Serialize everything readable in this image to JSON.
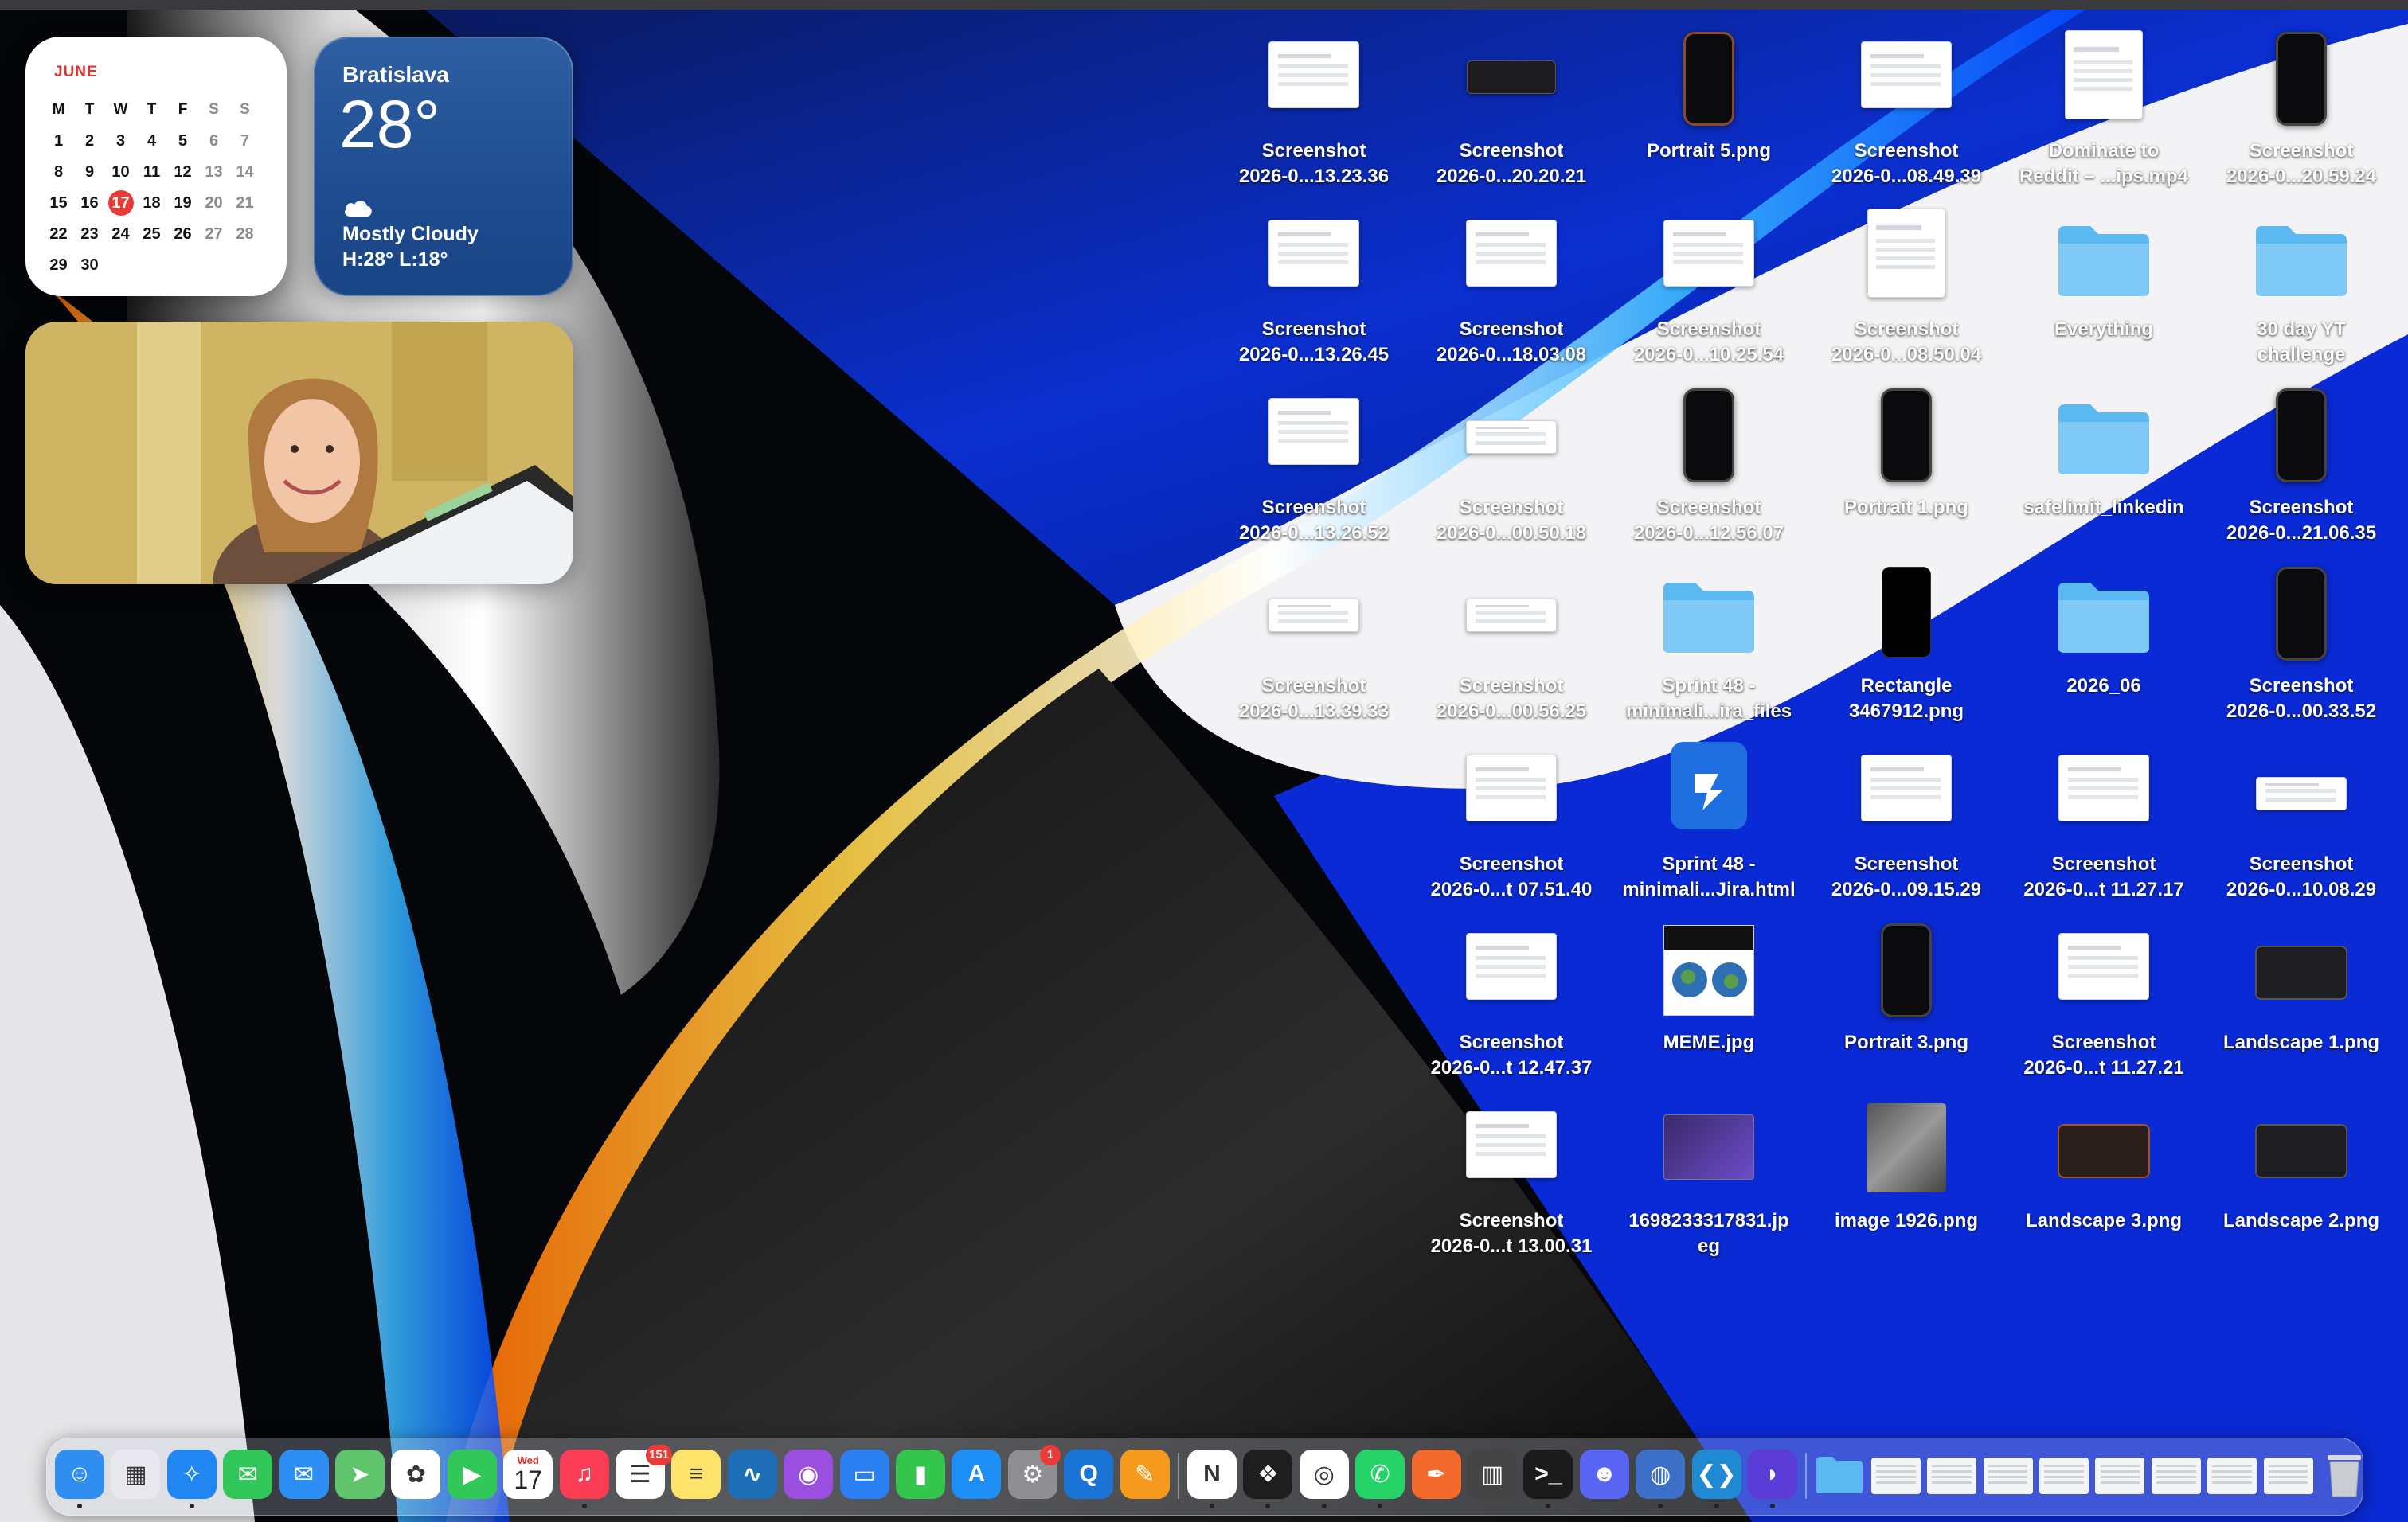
{
  "calendar": {
    "month": "JUNE",
    "weekdays": [
      "M",
      "T",
      "W",
      "T",
      "F",
      "S",
      "S"
    ],
    "weeks": [
      [
        "",
        "",
        "",
        "",
        "",
        "",
        ""
      ],
      [
        "1",
        "2",
        "3",
        "4",
        "5",
        "6",
        "7"
      ],
      [
        "8",
        "9",
        "10",
        "11",
        "12",
        "13",
        "14"
      ],
      [
        "15",
        "16",
        "17",
        "18",
        "19",
        "20",
        "21"
      ],
      [
        "22",
        "23",
        "24",
        "25",
        "26",
        "27",
        "28"
      ],
      [
        "29",
        "30",
        "",
        "",
        "",
        "",
        ""
      ]
    ],
    "today": "17"
  },
  "weather": {
    "city": "Bratislava",
    "temp": "28°",
    "condition": "Mostly Cloudy",
    "high_low": "H:28° L:18°",
    "icon": "cloud-icon"
  },
  "camera": {
    "icon": "webcam-preview"
  },
  "desktop_items": [
    {
      "label1": "Screenshot",
      "label2": "2026-0...13.23.36",
      "kind": "shot"
    },
    {
      "label1": "Screenshot",
      "label2": "2026-0...20.20.21",
      "kind": "dark"
    },
    {
      "label1": "Portrait 5.png",
      "label2": "",
      "kind": "phone-orange"
    },
    {
      "label1": "Screenshot",
      "label2": "2026-0...08.49.39",
      "kind": "shot"
    },
    {
      "label1": "Dominate to",
      "label2": "Reddit – ...ips.mp4",
      "kind": "shot-tall"
    },
    {
      "label1": "Screenshot",
      "label2": "2026-0...20.59.24",
      "kind": "phone"
    },
    {
      "label1": "Screenshot",
      "label2": "2026-0...13.26.45",
      "kind": "shot"
    },
    {
      "label1": "Screenshot",
      "label2": "2026-0...18.03.08",
      "kind": "shot"
    },
    {
      "label1": "Screenshot",
      "label2": "2026-0...10.25.54",
      "kind": "shot"
    },
    {
      "label1": "Screenshot",
      "label2": "2026-0...08.50.04",
      "kind": "shot-tall"
    },
    {
      "label1": "Everything",
      "label2": "",
      "kind": "folder"
    },
    {
      "label1": "30 day YT",
      "label2": "challenge",
      "kind": "folder"
    },
    {
      "label1": "Screenshot",
      "label2": "2026-0...13.26.52",
      "kind": "shot"
    },
    {
      "label1": "Screenshot",
      "label2": "2026-0...00.50.18",
      "kind": "shot-thin"
    },
    {
      "label1": "Screenshot",
      "label2": "2026-0...12.56.07",
      "kind": "phone"
    },
    {
      "label1": "Portrait 1.png",
      "label2": "",
      "kind": "phone"
    },
    {
      "label1": "safelimit_linkedin",
      "label2": "",
      "kind": "folder"
    },
    {
      "label1": "Screenshot",
      "label2": "2026-0...21.06.35",
      "kind": "phone"
    },
    {
      "label1": "Screenshot",
      "label2": "2026-0...13.39.33",
      "kind": "shot-thin"
    },
    {
      "label1": "Screenshot",
      "label2": "2026-0...00.56.25",
      "kind": "shot-thin"
    },
    {
      "label1": "Sprint 48 -",
      "label2": "minimali...ira_files",
      "kind": "folder"
    },
    {
      "label1": "Rectangle",
      "label2": "3467912.png",
      "kind": "black"
    },
    {
      "label1": "2026_06",
      "label2": "",
      "kind": "folder"
    },
    {
      "label1": "Screenshot",
      "label2": "2026-0...00.33.52",
      "kind": "phone"
    },
    {
      "label1": "",
      "label2": "",
      "kind": "empty"
    },
    {
      "label1": "Screenshot",
      "label2": "2026-0...t 07.51.40",
      "kind": "shot"
    },
    {
      "label1": "Sprint 48 -",
      "label2": "minimali...Jira.html",
      "kind": "jira"
    },
    {
      "label1": "Screenshot",
      "label2": "2026-0...09.15.29",
      "kind": "shot"
    },
    {
      "label1": "Screenshot",
      "label2": "2026-0...t 11.27.17",
      "kind": "shot"
    },
    {
      "label1": "Screenshot",
      "label2": "2026-0...10.08.29",
      "kind": "shot-thin"
    },
    {
      "label1": "",
      "label2": "",
      "kind": "empty"
    },
    {
      "label1": "Screenshot",
      "label2": "2026-0...t 12.47.37",
      "kind": "shot"
    },
    {
      "label1": "MEME.jpg",
      "label2": "",
      "kind": "meme"
    },
    {
      "label1": "Portrait 3.png",
      "label2": "",
      "kind": "phone"
    },
    {
      "label1": "Screenshot",
      "label2": "2026-0...t 11.27.21",
      "kind": "shot"
    },
    {
      "label1": "Landscape 1.png",
      "label2": "",
      "kind": "land"
    },
    {
      "label1": "",
      "label2": "",
      "kind": "empty"
    },
    {
      "label1": "Screenshot",
      "label2": "2026-0...t 13.00.31",
      "kind": "shot"
    },
    {
      "label1": "1698233317831.jp",
      "label2": "eg",
      "kind": "purple"
    },
    {
      "label1": "image 1926.png",
      "label2": "",
      "kind": "photo"
    },
    {
      "label1": "Landscape 3.png",
      "label2": "",
      "kind": "land-orange"
    },
    {
      "label1": "Landscape 2.png",
      "label2": "",
      "kind": "land"
    }
  ],
  "dock": {
    "calendar_day": "17",
    "calendar_weekday": "Wed",
    "reminders_badge": "151",
    "settings_badge": "1",
    "apps": [
      {
        "name": "finder-icon",
        "bg": "#2f8ef0",
        "glyph": "☺",
        "running": true
      },
      {
        "name": "launchpad-icon",
        "bg": "#e8e8ee",
        "glyph": "▦",
        "running": false
      },
      {
        "name": "safari-icon",
        "bg": "#1f86f2",
        "glyph": "✧",
        "running": true
      },
      {
        "name": "messages-icon",
        "bg": "#32c759",
        "glyph": "✉",
        "running": false
      },
      {
        "name": "mail-icon",
        "bg": "#2d8ff5",
        "glyph": "✉",
        "running": false
      },
      {
        "name": "maps-icon",
        "bg": "#5fc46b",
        "glyph": "➤",
        "running": false
      },
      {
        "name": "photos-icon",
        "bg": "#ffffff",
        "glyph": "✿",
        "running": false
      },
      {
        "name": "facetime-icon",
        "bg": "#32c759",
        "glyph": "▶",
        "running": false
      },
      {
        "name": "calendar-icon",
        "bg": "#ffffff",
        "glyph": "",
        "running": false
      },
      {
        "name": "music-icon",
        "bg": "#fa3c55",
        "glyph": "♫",
        "running": true
      },
      {
        "name": "reminders-icon",
        "bg": "#ffffff",
        "glyph": "☰",
        "running": false
      },
      {
        "name": "notes-icon",
        "bg": "#fde36a",
        "glyph": "≡",
        "running": false
      },
      {
        "name": "freeform-icon",
        "bg": "#1e6fb8",
        "glyph": "∿",
        "running": false
      },
      {
        "name": "podcasts-icon",
        "bg": "#9a4fe0",
        "glyph": "◉",
        "running": false
      },
      {
        "name": "keynote-icon",
        "bg": "#2b7ff0",
        "glyph": "▭",
        "running": false
      },
      {
        "name": "numbers-icon",
        "bg": "#33c54c",
        "glyph": "▮",
        "running": false
      },
      {
        "name": "app-store-icon",
        "bg": "#1c8ef5",
        "glyph": "A",
        "running": false
      },
      {
        "name": "system-settings-icon",
        "bg": "#8e8e93",
        "glyph": "⚙",
        "running": false
      },
      {
        "name": "quicktime-icon",
        "bg": "#1a74d6",
        "glyph": "Q",
        "running": false
      },
      {
        "name": "pages-icon",
        "bg": "#f59a1c",
        "glyph": "✎",
        "running": false
      },
      {
        "name": "notion-icon",
        "bg": "#ffffff",
        "glyph": "N",
        "running": true
      },
      {
        "name": "figma-icon",
        "bg": "#1e1e1e",
        "glyph": "❖",
        "running": true
      },
      {
        "name": "chrome-icon",
        "bg": "#ffffff",
        "glyph": "◎",
        "running": true
      },
      {
        "name": "whatsapp-icon",
        "bg": "#25d366",
        "glyph": "✆",
        "running": true
      },
      {
        "name": "pen-tool-icon",
        "bg": "#f26b2d",
        "glyph": "✒",
        "running": false
      },
      {
        "name": "grid-app-icon",
        "bg": "#444444",
        "glyph": "▥",
        "running": false
      },
      {
        "name": "terminal-icon",
        "bg": "#1b1b1b",
        "glyph": ">_",
        "running": true
      },
      {
        "name": "discord-icon",
        "bg": "#5865f2",
        "glyph": "☻",
        "running": false
      },
      {
        "name": "screen-tool-icon",
        "bg": "#3b6fc8",
        "glyph": "◍",
        "running": true
      },
      {
        "name": "vscode-icon",
        "bg": "#1f8ad2",
        "glyph": "❮❯",
        "running": true
      },
      {
        "name": "arc-browser-icon",
        "bg": "#5b3bd6",
        "glyph": "◗",
        "running": true
      }
    ],
    "recent": [
      {
        "name": "downloads-folder-icon"
      },
      {
        "name": "recent-window-1-icon"
      },
      {
        "name": "recent-window-2-icon"
      },
      {
        "name": "recent-window-3-icon"
      },
      {
        "name": "recent-window-4-icon"
      },
      {
        "name": "recent-window-5-icon"
      },
      {
        "name": "recent-window-6-icon"
      },
      {
        "name": "recent-window-7-icon"
      },
      {
        "name": "recent-window-8-icon"
      },
      {
        "name": "trash-icon"
      }
    ]
  }
}
